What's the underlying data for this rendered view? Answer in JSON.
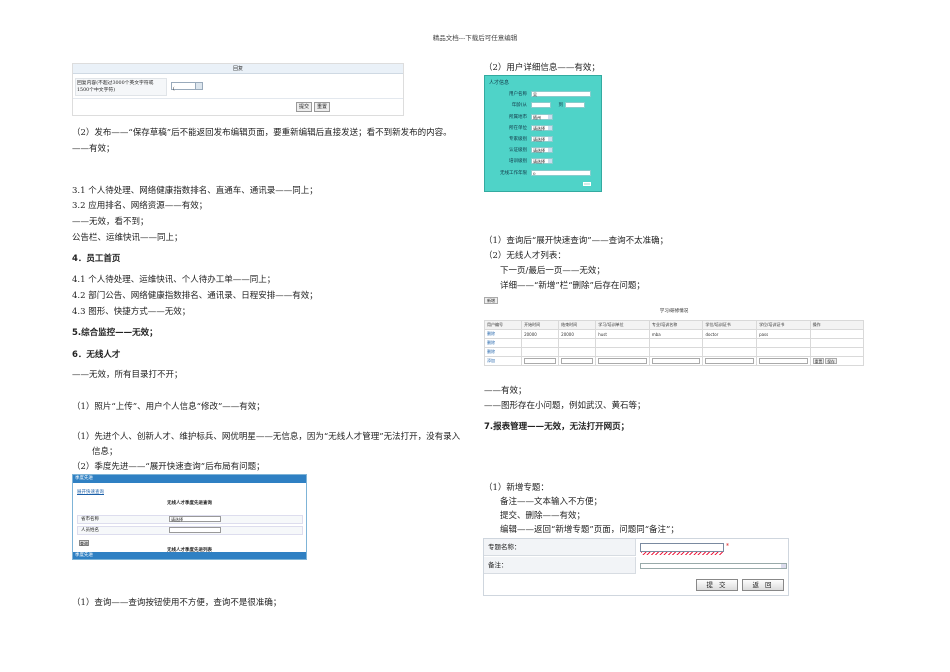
{
  "header": {
    "text": "精品文档---下载后可任意编辑"
  },
  "left": {
    "fig_reply": {
      "title": "回复",
      "label": "回复内容(不超过3000个英文字符或1500个中文字符)",
      "select_value": "(",
      "submit": "提交",
      "reset": "重置"
    },
    "lines": [
      "（2）发布——“保存草稿”后不能返回发布编辑页面，要重新编辑后直接发送；看不到新发布的内容。",
      "——有效；",
      "3.1 个人待处理、网络健康指数排名、直通车、通讯录——同上；",
      "3.2 应用排名、网络资源——有效；",
      "——无效，看不到；",
      "公告栏、运维快讯——同上；",
      "4．员工首页",
      "4.1 个人待处理、运维快讯、个人待办工单——同上；",
      "4.2 部门公告、网络健康指数排名、通讯录、日程安排——有效；",
      "4.3 图形、快捷方式——无效；",
      "5.综合监控——无效；",
      "6．无线人才",
      "——无效，所有目录打不开；",
      "（1）照片“上传”、用户个人信息“修改”——有效；",
      "（1）先进个人、创新人才、维护标兵、网优明星——无信息，因为“无线人才管理”无法打开，没有录入",
      "信息；",
      "（2）季度先进——“展开快速查询”后布局有问题；",
      "（1）查询——查询按钮使用不方便，查询不是很准确；"
    ],
    "fig_season": {
      "top_bar": "季度先进",
      "link": "展开快速查询",
      "title1": "无线人才季度先进查询",
      "row1_label": "省市名称",
      "row1_value": "请选择",
      "row2_label": "人员姓名",
      "query_btn": "查询",
      "title2": "无线人才季度先进列表",
      "bottom_bar": "季度先进"
    }
  },
  "right": {
    "lines": [
      "（2）用户详细信息——有效；",
      "（1）查询后“展开快速查询”——查询不太准确；",
      "（2）无线人才列表：",
      "下一页/最后一页——无效；",
      "详细——“新增”栏“删除”后存在问题；",
      "——有效；",
      "——图形存在小问题，例如武汉、黄石等；",
      "7.报表管理——无效，无法打开网页；",
      "（1）新增专题：",
      "备注——文本输入不方便；",
      "提交、删除——有效；",
      "编辑——返回“新增专题”页面，问题同“备注”；"
    ],
    "fig_user": {
      "title": "人才信息",
      "fields": [
        {
          "label": "用户名称",
          "value": "吴"
        },
        {
          "label": "年龄(从",
          "value": "",
          "mid": "到"
        },
        {
          "label": "所属地市",
          "value": "随州"
        },
        {
          "label": "所在单位",
          "value": "请选择"
        },
        {
          "label": "专家级别",
          "value": "请选择"
        },
        {
          "label": "认证级别",
          "value": "请选择"
        },
        {
          "label": "培训级别",
          "value": "请选择"
        },
        {
          "label": "无线工作年限",
          "value": "0"
        }
      ]
    },
    "fig_table": {
      "new_btn": "新增",
      "title": "学习/研修情况",
      "headers": [
        "用户编号",
        "开始时间",
        "结束时间",
        "学习/培训单位",
        "专业/培训名称",
        "学位/培训证书",
        "学位/培训证书",
        "操作"
      ],
      "rows": [
        [
          "删除",
          "20000",
          "20000",
          "hust",
          "mba",
          "doctor",
          "pass",
          ""
        ],
        [
          "删除",
          "",
          "",
          "",
          "",
          "",
          "",
          ""
        ],
        [
          "删除",
          "",
          "",
          "",
          "",
          "",
          "",
          ""
        ],
        [
          "添加",
          "",
          "",
          "",
          "",
          "",
          "",
          ""
        ]
      ],
      "action_btns": [
        "重置",
        "保存"
      ]
    },
    "fig_topic": {
      "name_label": "专题名称：",
      "note_label": "备注：",
      "required": "*",
      "submit": "提 交",
      "back": "返 回"
    }
  }
}
